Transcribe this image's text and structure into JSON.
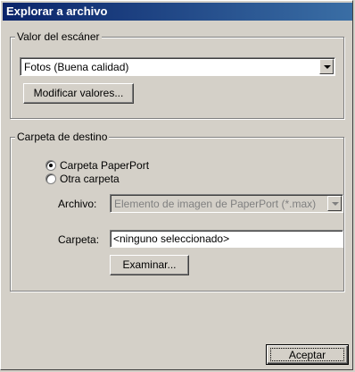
{
  "window": {
    "title": "Explorar a archivo"
  },
  "scanner": {
    "group_label": "Valor del escáner",
    "combo_value": "Fotos (Buena calidad)",
    "modify_button": "Modificar valores..."
  },
  "destination": {
    "group_label": "Carpeta de destino",
    "radio_paperport": "Carpeta PaperPort",
    "radio_other": "Otra carpeta",
    "selected": "paperport",
    "file_label": "Archivo:",
    "file_value": "Elemento de imagen de PaperPort (*.max)",
    "folder_label": "Carpeta:",
    "folder_value": "<ninguno seleccionado>",
    "browse_button": "Examinar..."
  },
  "footer": {
    "ok_button": "Aceptar"
  }
}
